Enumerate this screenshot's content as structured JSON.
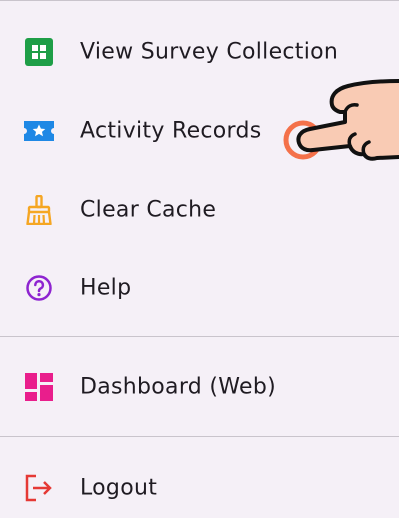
{
  "menu": {
    "items": [
      {
        "label": "View Survey Collection",
        "icon": "grid-icon",
        "color": "#1e9e47"
      },
      {
        "label": "Activity Records",
        "icon": "star-ticket-icon",
        "color": "#1e88e5"
      },
      {
        "label": "Clear Cache",
        "icon": "broom-icon",
        "color": "#f5a623"
      },
      {
        "label": "Help",
        "icon": "help-circle-icon",
        "color": "#8e24d0"
      }
    ],
    "secondary_items": [
      {
        "label": "Dashboard (Web)",
        "icon": "dashboard-icon",
        "color": "#e91e8c"
      }
    ],
    "footer_items": [
      {
        "label": "Logout",
        "icon": "logout-icon",
        "color": "#e53935"
      }
    ]
  },
  "overlay": {
    "icon": "pointing-hand-icon",
    "tap_indicator_color": "#f4511e"
  }
}
